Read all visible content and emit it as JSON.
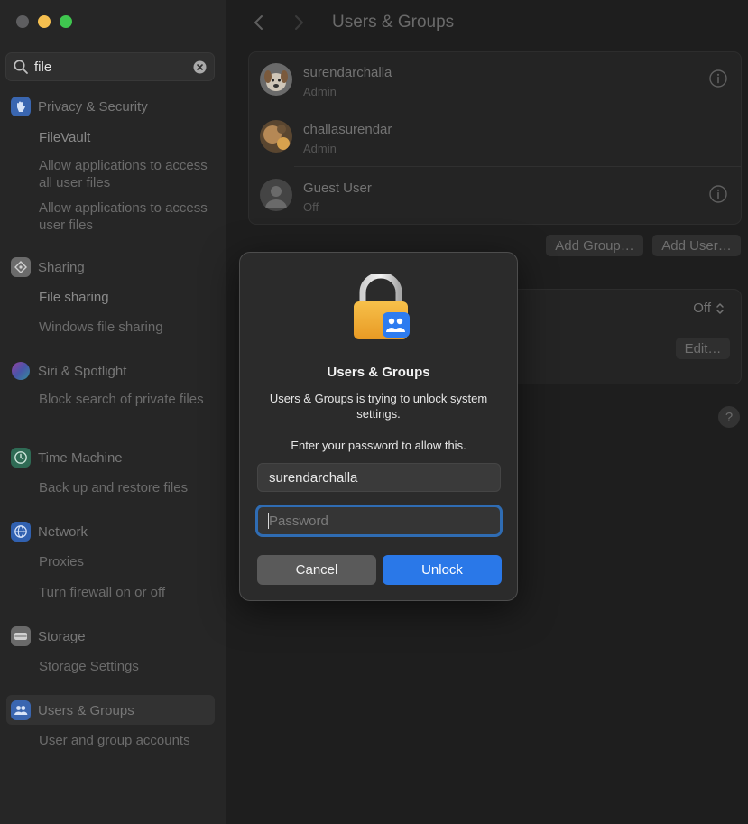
{
  "window": {
    "title": "Users & Groups"
  },
  "search": {
    "query": "file"
  },
  "sidebar": {
    "sections": [
      {
        "label": "Privacy & Security",
        "icon": "hand-icon",
        "color": "#3f7ae0",
        "items": [
          "FileVault",
          "Allow applications to access all user files",
          "Allow applications to access user files"
        ]
      },
      {
        "label": "Sharing",
        "icon": "sharing-icon",
        "color": "#8c8c8c",
        "items": [
          "File sharing",
          "Windows file sharing"
        ]
      },
      {
        "label": "Siri & Spotlight",
        "icon": "siri-icon",
        "color": "#c052e0",
        "items": [
          "Block search of private files"
        ]
      },
      {
        "label": "Time Machine",
        "icon": "time-machine-icon",
        "color": "#3d9b74",
        "items": [
          "Back up and restore files"
        ]
      },
      {
        "label": "Network",
        "icon": "globe-icon",
        "color": "#3b7be0",
        "items": [
          "Proxies",
          "Turn firewall on or off"
        ]
      },
      {
        "label": "Storage",
        "icon": "storage-icon",
        "color": "#8a8a8a",
        "items": [
          "Storage Settings"
        ]
      },
      {
        "label": "Users & Groups",
        "icon": "users-icon",
        "color": "#3f7ae0",
        "items": [
          "User and group accounts"
        ]
      }
    ]
  },
  "main": {
    "users": [
      {
        "name": "surendarchalla",
        "role": "Admin"
      },
      {
        "name": "challasurendar",
        "role": "Admin"
      },
      {
        "name": "Guest User",
        "role": "Off"
      }
    ],
    "add_group_label": "Add Group…",
    "add_user_label": "Add User…",
    "auto_login_value": "Off",
    "edit_label": "Edit…",
    "help_label": "?"
  },
  "dialog": {
    "title": "Users & Groups",
    "message": "Users & Groups is trying to unlock system settings.",
    "prompt": "Enter your password to allow this.",
    "username": "surendarchalla",
    "password_placeholder": "Password",
    "cancel_label": "Cancel",
    "unlock_label": "Unlock",
    "accent": "#2a78e8"
  }
}
